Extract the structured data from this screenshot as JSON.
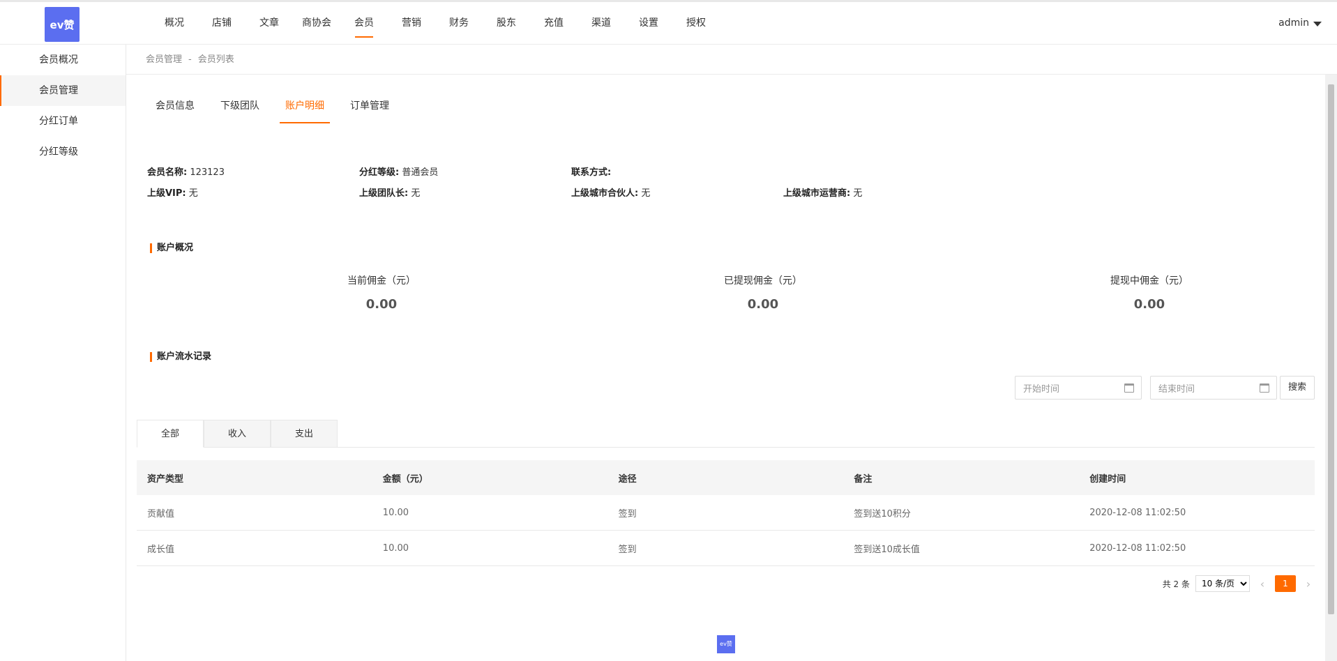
{
  "header": {
    "logo_text": "ev赞",
    "nav": [
      "概况",
      "店铺",
      "文章",
      "商协会",
      "会员",
      "营销",
      "财务",
      "股东",
      "充值",
      "渠道",
      "设置",
      "授权"
    ],
    "active_nav_index": 4,
    "user": "admin"
  },
  "sidebar": {
    "items": [
      "会员概况",
      "会员管理",
      "分红订单",
      "分红等级"
    ],
    "active_index": 1
  },
  "breadcrumb": {
    "parent": "会员管理",
    "separator": "-",
    "current": "会员列表"
  },
  "tabs": {
    "items": [
      "会员信息",
      "下级团队",
      "账户明细",
      "订单管理"
    ],
    "active_index": 2
  },
  "member_info": {
    "name_label": "会员名称:",
    "name_value": "123123",
    "level_label": "分红等级:",
    "level_value": "普通会员",
    "contact_label": "联系方式:",
    "contact_value": "",
    "vip_label": "上级VIP:",
    "vip_value": "无",
    "leader_label": "上级团队长:",
    "leader_value": "无",
    "partner_label": "上级城市合伙人:",
    "partner_value": "无",
    "operator_label": "上级城市运营商:",
    "operator_value": "无"
  },
  "account_overview": {
    "title": "账户概况",
    "stats": [
      {
        "label": "当前佣金（元）",
        "value": "0.00"
      },
      {
        "label": "已提现佣金（元）",
        "value": "0.00"
      },
      {
        "label": "提现中佣金（元）",
        "value": "0.00"
      }
    ]
  },
  "records": {
    "title": "账户流水记录",
    "start_placeholder": "开始时间",
    "end_placeholder": "结束时间",
    "search_label": "搜索",
    "subtabs": [
      "全部",
      "收入",
      "支出"
    ],
    "active_subtab": 0,
    "columns": [
      "资产类型",
      "金额（元）",
      "途径",
      "备注",
      "创建时间"
    ],
    "rows": [
      [
        "贡献值",
        "10.00",
        "签到",
        "签到送10积分",
        "2020-12-08 11:02:50"
      ],
      [
        "成长值",
        "10.00",
        "签到",
        "签到送10成长值",
        "2020-12-08 11:02:50"
      ]
    ]
  },
  "pagination": {
    "total": "共 2 条",
    "page_size": "10 条/页",
    "current_page": "1"
  },
  "colors": {
    "accent": "#ff6a00",
    "logo_bg": "#5b6ef0"
  }
}
